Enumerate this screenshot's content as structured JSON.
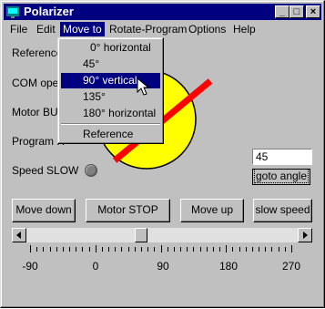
{
  "window": {
    "title": "Polarizer",
    "minimize": "_",
    "maximize": "□",
    "close": "×"
  },
  "menubar": {
    "items": [
      {
        "label": "File"
      },
      {
        "label": "Edit"
      },
      {
        "label": "Move to"
      },
      {
        "label": "Rotate-Program"
      },
      {
        "label": "Options"
      },
      {
        "label": "Help"
      }
    ]
  },
  "dropdown": {
    "items": [
      {
        "label": "0° horizontal"
      },
      {
        "label": "45°"
      },
      {
        "label": "90° vertical",
        "selected": true
      },
      {
        "label": "135°"
      },
      {
        "label": "180° horizontal"
      },
      {
        "label": "Reference"
      }
    ]
  },
  "status": {
    "reference": "Reference",
    "com_open": "COM open",
    "motor_busy": "Motor BUSY",
    "program_run": "Program R",
    "speed_slow": "Speed SLOW"
  },
  "angle_input": {
    "value": "45"
  },
  "goto_button": {
    "label": "goto angle"
  },
  "buttons": {
    "move_down": "Move down",
    "motor_stop": "Motor STOP",
    "move_up": "Move up",
    "slow_speed": "slow speed"
  },
  "scale": {
    "labels": [
      "-90",
      "0",
      "90",
      "180",
      "270"
    ]
  },
  "slider": {
    "value_fraction": 0.42
  },
  "colors": {
    "dial_fill": "#ffff00",
    "pointer": "#ff0000",
    "titlebar": "#000080",
    "window": "#c0c0c0"
  }
}
